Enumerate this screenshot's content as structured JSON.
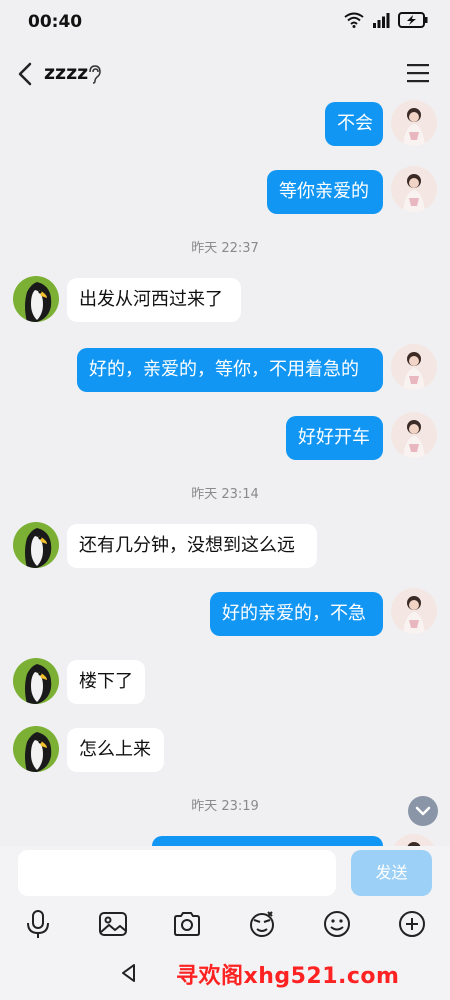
{
  "status": {
    "time": "00:40"
  },
  "header": {
    "title": "zzzz"
  },
  "messages": {
    "m1": "不会",
    "m2": "等你亲爱的",
    "ts1": "昨天 22:37",
    "m3": "出发从河西过来了",
    "m4": "好的，亲爱的，等你，不用着急的",
    "m5": "好好开车",
    "ts2": "昨天 23:14",
    "m6": "还有几分钟，没想到这么远",
    "m7": "好的亲爱的，不急",
    "m8": "楼下了",
    "m9": "怎么上来",
    "ts3": "昨天 23:19"
  },
  "input": {
    "placeholder": "",
    "send_label": "发送"
  },
  "toolbar": {
    "icons": [
      "mic-icon",
      "image-icon",
      "camera-icon",
      "sticker-icon",
      "emoji-icon",
      "plus-icon"
    ]
  },
  "watermark": {
    "text": "寻欢阁xhg521.com"
  },
  "colors": {
    "outgoing": "#1296f3",
    "incoming": "#ffffff",
    "background": "#f0f0f2",
    "send_disabled": "#9dd0f6"
  }
}
